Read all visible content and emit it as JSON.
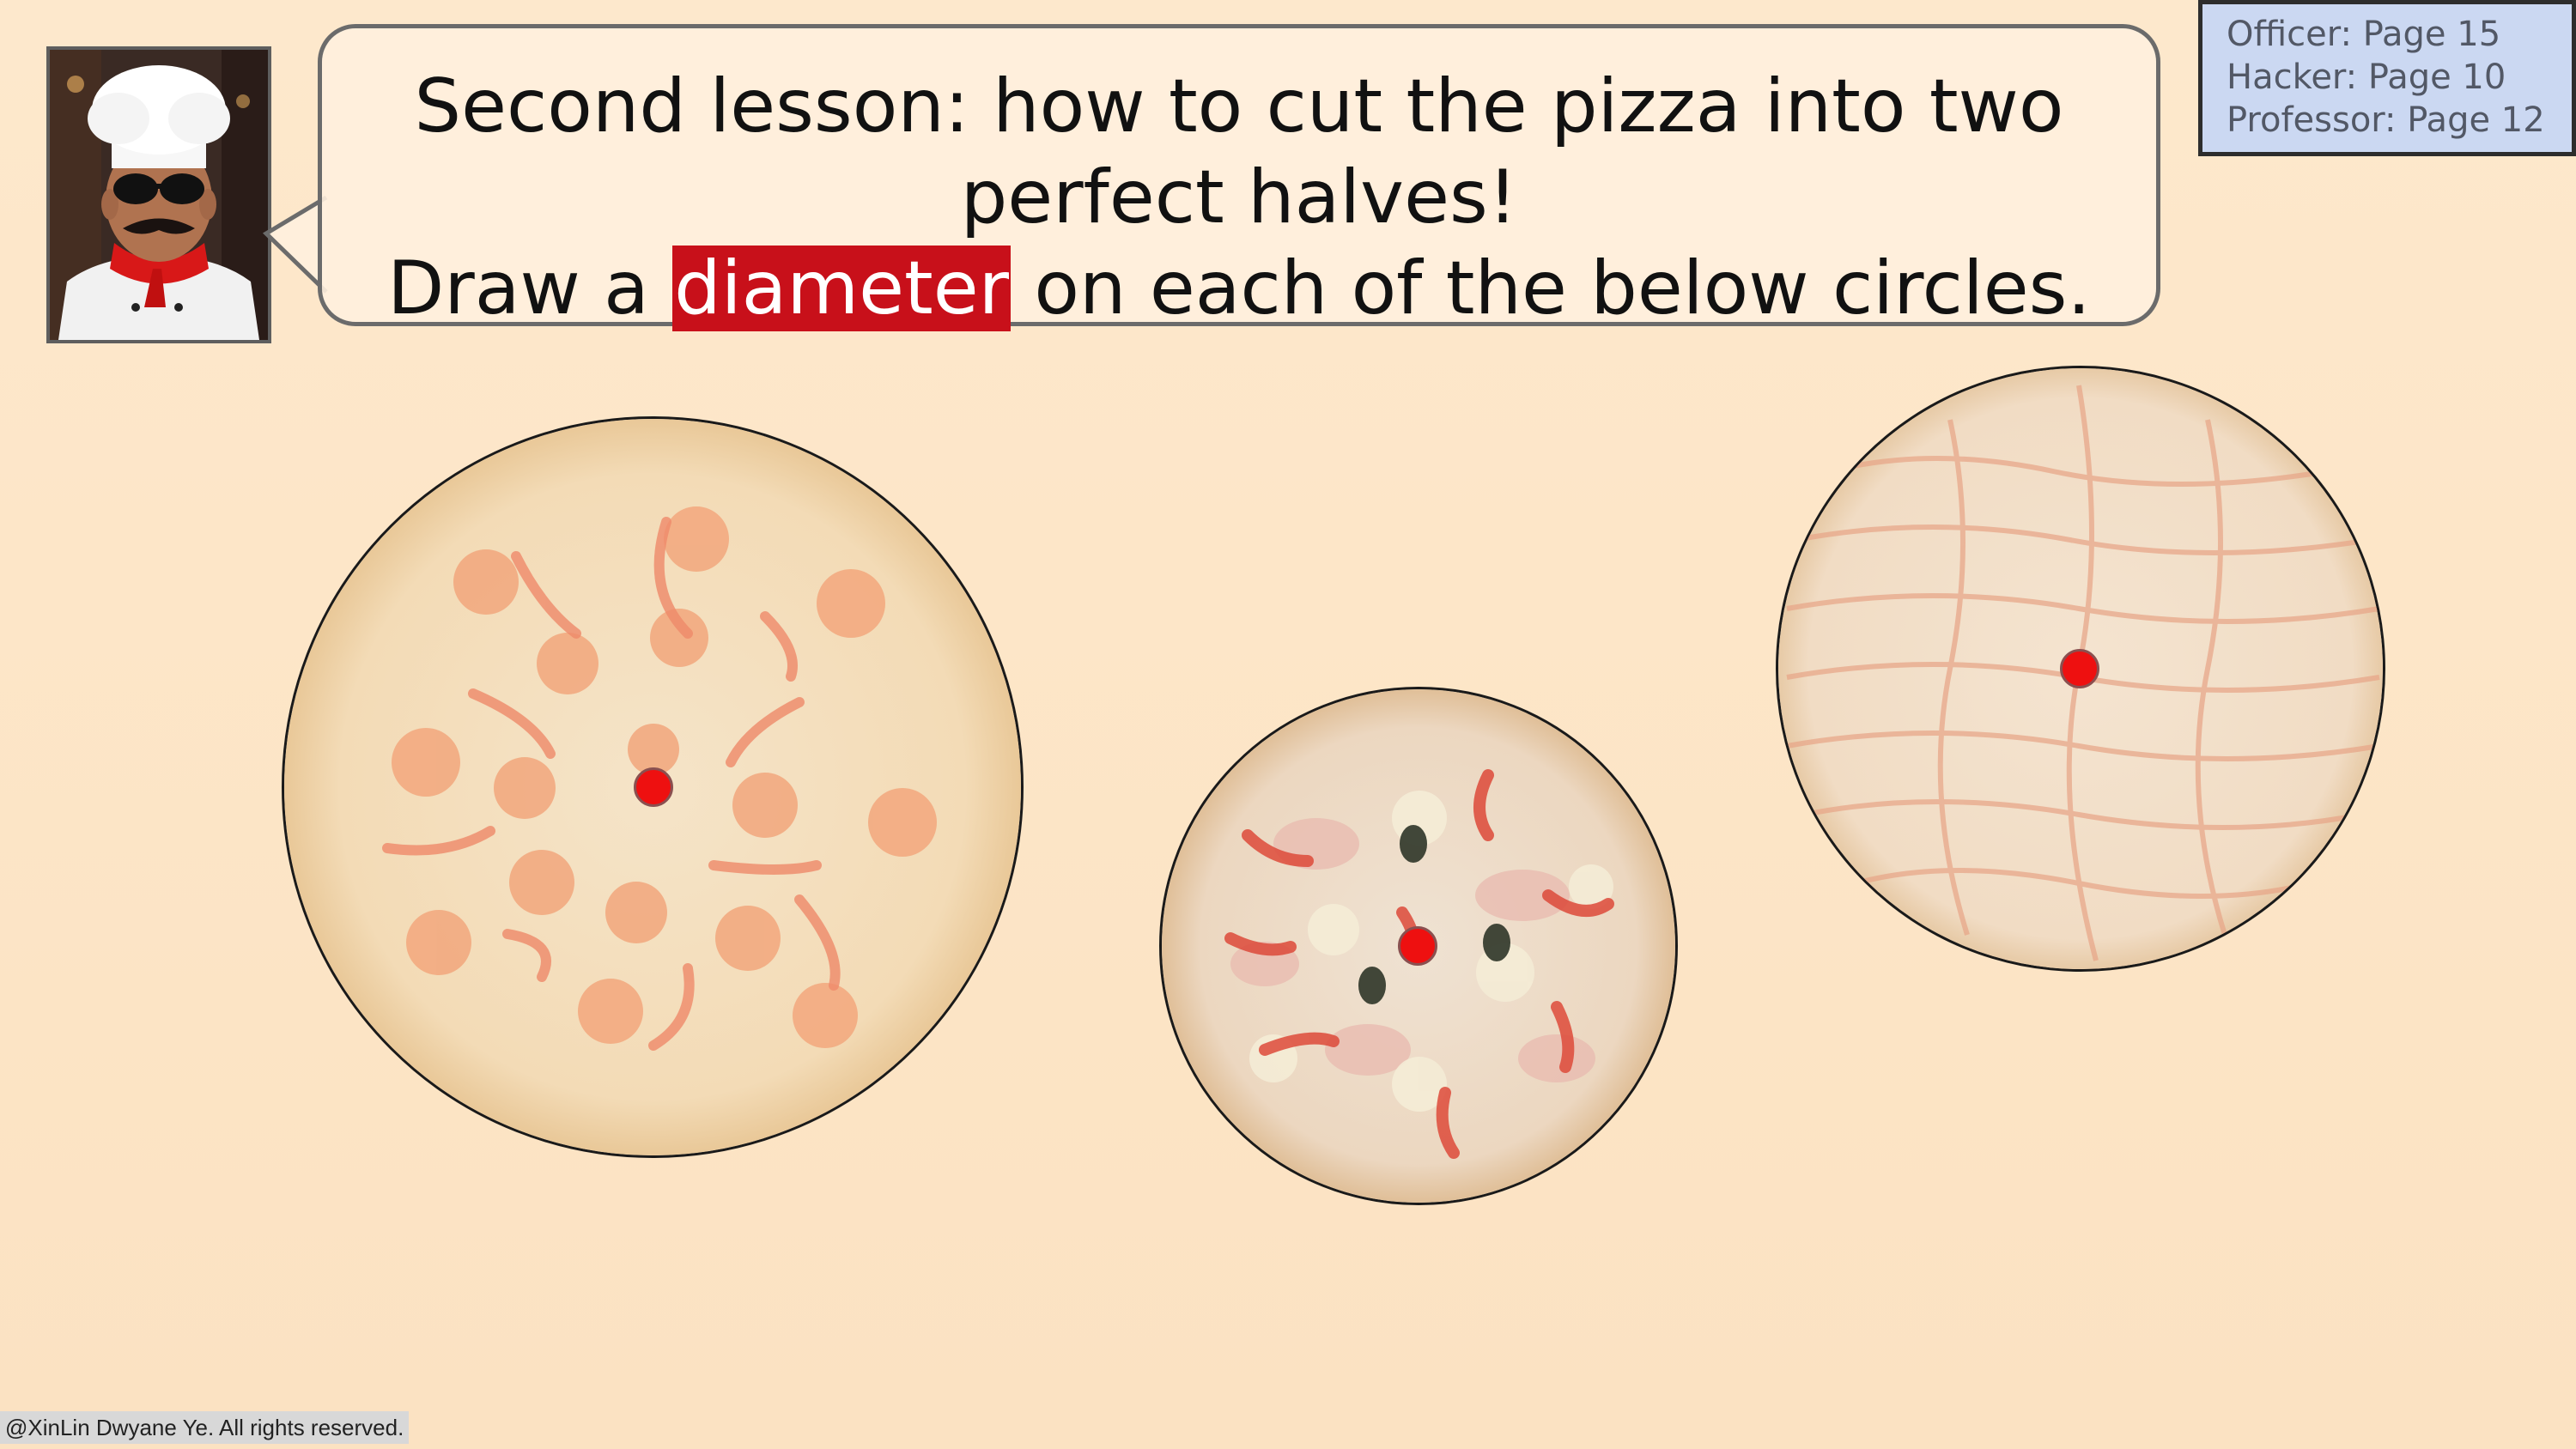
{
  "speech": {
    "line1": "Second lesson: how to cut the pizza into two",
    "line2": "perfect halves!",
    "line3_before": "Draw a ",
    "line3_highlight": "diameter",
    "line3_after": " on each of the below circles."
  },
  "pages": [
    "Officer: Page 15",
    "Hacker: Page 10",
    "Professor: Page 12"
  ],
  "copyright": "@XinLin Dwyane Ye. All rights reserved.",
  "colors": {
    "highlight": "#c8101a",
    "center_dot": "#ee1010",
    "page_box": "#cbd8f2"
  },
  "icons": {
    "chef": "chef-portrait",
    "pizzas": [
      "pepper-tomato-pizza",
      "mushroom-olive-pizza",
      "cheese-sauce-pizza"
    ]
  }
}
